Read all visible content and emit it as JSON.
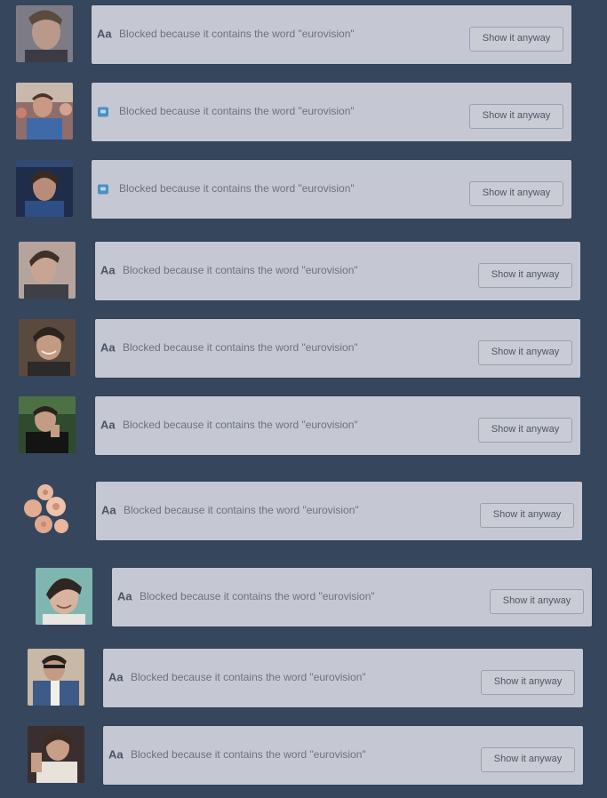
{
  "colors": {
    "background": "#36465d",
    "card": "#c5c8d2",
    "text": "#6b7280"
  },
  "posts": [
    {
      "message": "Blocked because it contains the word \"eurovision\"",
      "button": "Show it anyway",
      "type_icon": "text",
      "type_label": "Aa"
    },
    {
      "message": "Blocked because it contains the word \"eurovision\"",
      "button": "Show it anyway",
      "type_icon": "photo"
    },
    {
      "message": "Blocked because it contains the word \"eurovision\"",
      "button": "Show it anyway",
      "type_icon": "photo"
    },
    {
      "message": "Blocked because it contains the word \"eurovision\"",
      "button": "Show it anyway",
      "type_icon": "text",
      "type_label": "Aa"
    },
    {
      "message": "Blocked because it contains the word \"eurovision\"",
      "button": "Show it anyway",
      "type_icon": "text",
      "type_label": "Aa"
    },
    {
      "message": "Blocked because it contains the word \"eurovision\"",
      "button": "Show it anyway",
      "type_icon": "text",
      "type_label": "Aa"
    },
    {
      "message": "Blocked because it contains the word \"eurovision\"",
      "button": "Show it anyway",
      "type_icon": "text",
      "type_label": "Aa"
    },
    {
      "message": "Blocked because it contains the word \"eurovision\"",
      "button": "Show it anyway",
      "type_icon": "text",
      "type_label": "Aa"
    },
    {
      "message": "Blocked because it contains the word \"eurovision\"",
      "button": "Show it anyway",
      "type_icon": "text",
      "type_label": "Aa"
    },
    {
      "message": "Blocked because it contains the word \"eurovision\"",
      "button": "Show it anyway",
      "type_icon": "text",
      "type_label": "Aa"
    }
  ]
}
